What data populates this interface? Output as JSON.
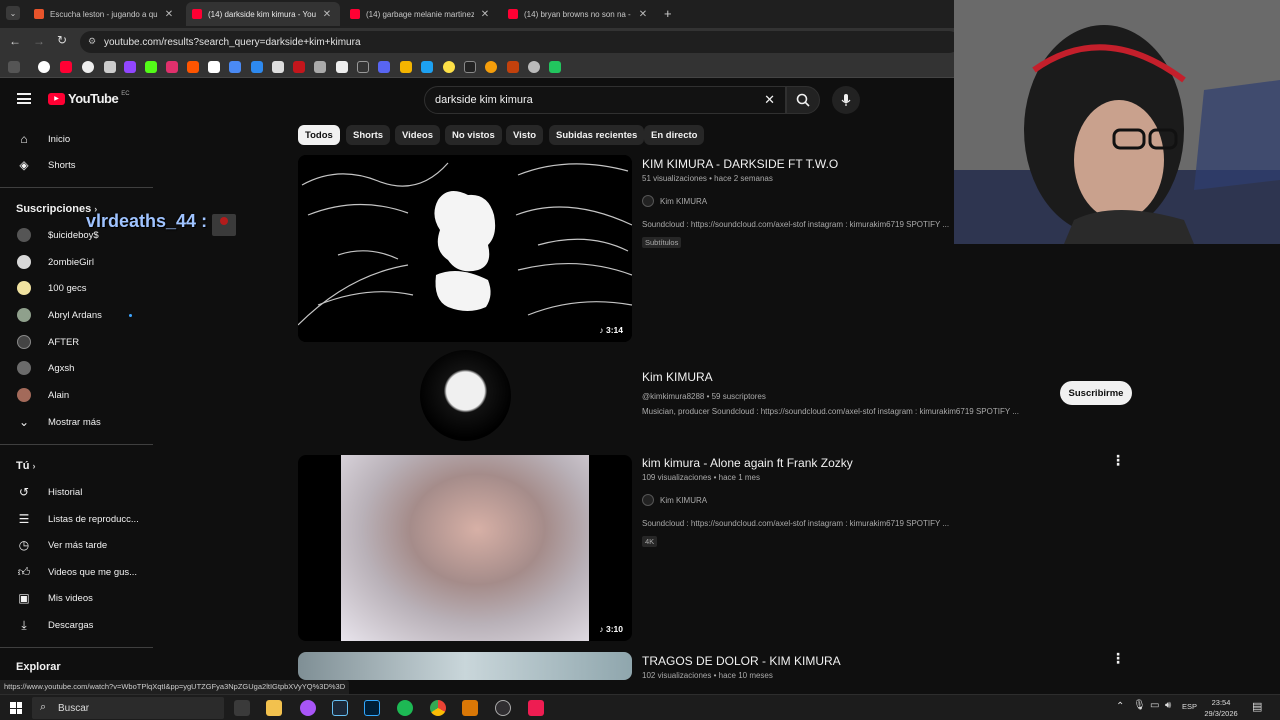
{
  "browser": {
    "tabs": [
      {
        "title": "Escucha leston - jugando a que",
        "color": "#e8542b"
      },
      {
        "title": "(14) darkside kim kimura - YouT",
        "color": "#ff0033"
      },
      {
        "title": "(14) garbage melanie martinez",
        "color": "#ff0033"
      },
      {
        "title": "(14) bryan browns no son na - Y",
        "color": "#ff0033"
      }
    ],
    "url": "youtube.com/results?search_query=darkside+kim+kimura",
    "status_url": "https://www.youtube.com/watch?v=WboTPlqXqtI&pp=ygUTZGFya3NpZGUga2ltIGtpbXVyYQ%3D%3D"
  },
  "youtube": {
    "logo_text": "YouTube",
    "region": "EC",
    "search_value": "darkside kim kimura",
    "chips": [
      "Todos",
      "Shorts",
      "Videos",
      "No vistos",
      "Visto",
      "Subidas recientes",
      "En directo"
    ],
    "sidebar": {
      "top": [
        {
          "label": "Inicio",
          "icon": "home-icon"
        },
        {
          "label": "Shorts",
          "icon": "shorts-icon"
        }
      ],
      "subs_heading": "Suscripciones",
      "subs": [
        {
          "label": "$uicideboy$"
        },
        {
          "label": "2ombieGirl"
        },
        {
          "label": "100 gecs"
        },
        {
          "label": "Abryl Ardans"
        },
        {
          "label": "AFTER"
        },
        {
          "label": "Agxsh"
        },
        {
          "label": "Alain"
        }
      ],
      "show_more": "Mostrar más",
      "you_heading": "Tú",
      "you_items": [
        {
          "label": "Historial",
          "icon": "history-icon"
        },
        {
          "label": "Listas de reproducc...",
          "icon": "playlists-icon"
        },
        {
          "label": "Ver más tarde",
          "icon": "watch-later-icon"
        },
        {
          "label": "Videos que me gus...",
          "icon": "like-icon"
        },
        {
          "label": "Mis videos",
          "icon": "your-videos-icon"
        },
        {
          "label": "Descargas",
          "icon": "download-icon"
        }
      ],
      "explore_heading": "Explorar"
    },
    "results": [
      {
        "title": "KIM KIMURA - DARKSIDE FT T.W.O",
        "meta": "51 visualizaciones • hace 2 semanas",
        "channel": "Kim KIMURA",
        "desc": "Soundcloud : https://soundcloud.com/axel-stof instagram : kimurakim6719 SPOTIFY ...",
        "badge": "Subtítulos",
        "duration": "3:14"
      },
      {
        "title": "kim kimura - Alone again ft Frank Zozky",
        "meta": "109 visualizaciones • hace 1 mes",
        "channel": "Kim KIMURA",
        "desc": "Soundcloud : https://soundcloud.com/axel-stof instagram : kimurakim6719 SPOTIFY ...",
        "badge": "4K",
        "duration": "3:10"
      },
      {
        "title": "TRAGOS DE DOLOR - KIM KIMURA",
        "meta": "102 visualizaciones • hace 10 meses"
      }
    ],
    "channel_result": {
      "name": "Kim KIMURA",
      "meta": "@kimkimura8288 • 59 suscriptores",
      "desc": "Musician, producer Soundcloud : https://soundcloud.com/axel-stof instagram : kimurakim6719 SPOTIFY ...",
      "subscribe_label": "Suscribirme"
    }
  },
  "stream_overlay": {
    "chat_user": "vlrdeaths_44 :"
  },
  "taskbar": {
    "search_label": "Buscar",
    "lang": "ESP",
    "time": "23:54",
    "date": "29/3/2026"
  }
}
